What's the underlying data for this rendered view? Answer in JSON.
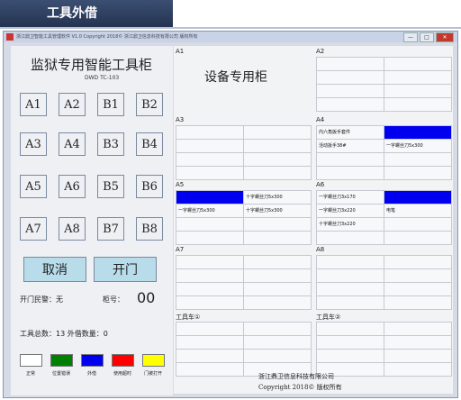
{
  "banner": {
    "title": "工具外借"
  },
  "window": {
    "title": "浙江鼎卫智能工具管理软件 V1.0    Copyright 2018© 浙江鼎卫信息科技有限公司 版权所有",
    "buttons": {
      "min": "—",
      "max": "□",
      "close": "✕"
    }
  },
  "left": {
    "brand": "监狱专用智能工具柜",
    "model": "DWD  TC-103",
    "slots": [
      {
        "label": "A1",
        "color": "blue"
      },
      {
        "label": "A2",
        "color": "blue"
      },
      {
        "label": "B1",
        "color": "grey"
      },
      {
        "label": "B2",
        "color": "grey"
      },
      {
        "label": "A3",
        "color": "yellow"
      },
      {
        "label": "A4",
        "color": "yellow"
      },
      {
        "label": "B3",
        "color": "grey"
      },
      {
        "label": "B4",
        "color": "grey"
      },
      {
        "label": "A5",
        "color": "yellow"
      },
      {
        "label": "A6",
        "color": "yellow"
      },
      {
        "label": "B5",
        "color": "grey"
      },
      {
        "label": "B6",
        "color": "yellow"
      },
      {
        "label": "A7",
        "color": "blue"
      },
      {
        "label": "A8",
        "color": "blue"
      },
      {
        "label": "B7",
        "color": "grey"
      },
      {
        "label": "B8",
        "color": "grey"
      }
    ],
    "cancel": "取消",
    "open": "开门",
    "door_alarm": "开门民警：无",
    "cabinet_label": "柜号：",
    "cabinet_no": "00",
    "totals": "工具总数：13  外借数量：0",
    "legend": [
      {
        "label": "正常",
        "color": "#ffffff"
      },
      {
        "label": "位置错误",
        "color": "#008000"
      },
      {
        "label": "外借",
        "color": "#0000ee"
      },
      {
        "label": "使用超时",
        "color": "#ff0000"
      },
      {
        "label": "门被打开",
        "color": "#ffff00"
      }
    ]
  },
  "right": {
    "a1": {
      "label": "A1",
      "title": "设备专用柜"
    },
    "a2": {
      "label": "A2",
      "cells": [
        "",
        "",
        "",
        "",
        "",
        "",
        "",
        ""
      ]
    },
    "a3": {
      "label": "A3",
      "cells": [
        "",
        "",
        "",
        "",
        "",
        "",
        "",
        ""
      ]
    },
    "a4": {
      "label": "A4",
      "cells": [
        "内六角扳手套件",
        "",
        "活动扳手38#",
        "一字螺丝刀5x300",
        "",
        "",
        "",
        ""
      ]
    },
    "a5": {
      "label": "A5",
      "cells": [
        "",
        "十字螺丝刀5x300",
        "一字螺丝刀5x300",
        "十字螺丝刀5x300",
        "",
        "",
        "",
        ""
      ]
    },
    "a6": {
      "label": "A6",
      "cells": [
        "一字螺丝刀3x170",
        "",
        "一字螺丝刀3x220",
        "电笔",
        "十字螺丝刀3x220",
        "",
        "",
        ""
      ]
    },
    "a7": {
      "label": "A7",
      "cells": [
        "",
        "",
        "",
        "",
        "",
        "",
        "",
        ""
      ]
    },
    "a8": {
      "label": "A8",
      "cells": [
        "",
        "",
        "",
        "",
        "",
        "",
        "",
        ""
      ]
    },
    "cart1": {
      "label": "工具车①",
      "cells": [
        "",
        "",
        "",
        "",
        "",
        "",
        "",
        ""
      ]
    },
    "cart2": {
      "label": "工具车②",
      "cells": [
        "",
        "",
        "",
        "",
        "",
        "",
        "",
        ""
      ]
    },
    "company": "浙江鼎卫信息科技有限公司",
    "copyright": "Copyright 2018©  版权所有"
  }
}
